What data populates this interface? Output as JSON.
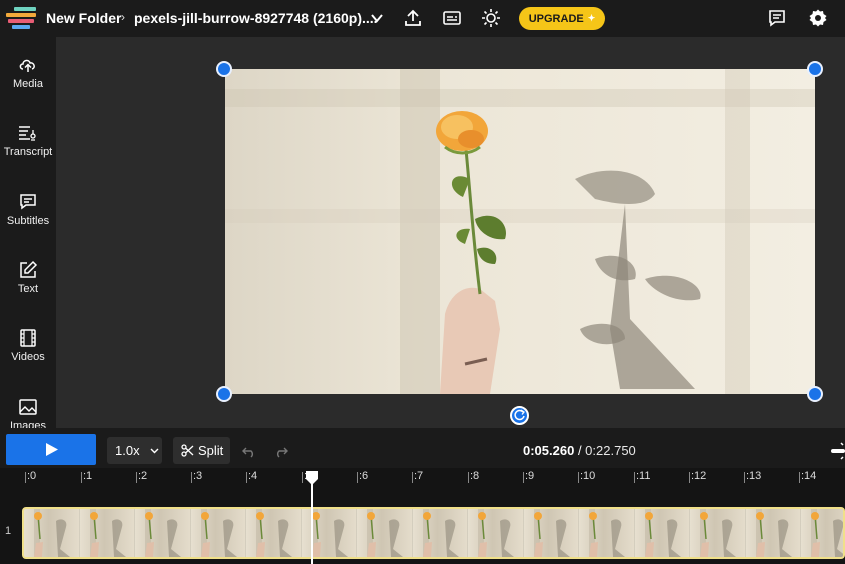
{
  "header": {
    "folder": "New Folder",
    "separator": "›",
    "filename": "pexels-jill-burrow-8927748 (2160p)....",
    "upgrade_label": "UPGRADE",
    "icons": [
      "upload-icon",
      "captions-icon",
      "brightness-icon",
      "comment-icon",
      "gear-icon"
    ]
  },
  "sidebar": {
    "items": [
      {
        "label": "Media",
        "icon": "upload-cloud-icon"
      },
      {
        "label": "Transcript",
        "icon": "transcript-icon"
      },
      {
        "label": "Subtitles",
        "icon": "subtitles-icon"
      },
      {
        "label": "Text",
        "icon": "edit-text-icon"
      },
      {
        "label": "Videos",
        "icon": "film-icon"
      },
      {
        "label": "Images",
        "icon": "image-icon"
      }
    ]
  },
  "controls": {
    "speed": "1.0x",
    "split_label": "Split",
    "current_time": "0:05.260",
    "time_sep": " / ",
    "total_time": "0:22.750"
  },
  "timeline": {
    "ticks": [
      ":0",
      ":1",
      ":2",
      ":3",
      ":4",
      ":5",
      ":6",
      ":7",
      ":8",
      ":9",
      ":10",
      ":11",
      ":12",
      ":13",
      ":14"
    ],
    "track_number": "1"
  },
  "colors": {
    "accent": "#1a73e8",
    "upgrade": "#f5c518",
    "clip_border": "#f0e08a"
  }
}
